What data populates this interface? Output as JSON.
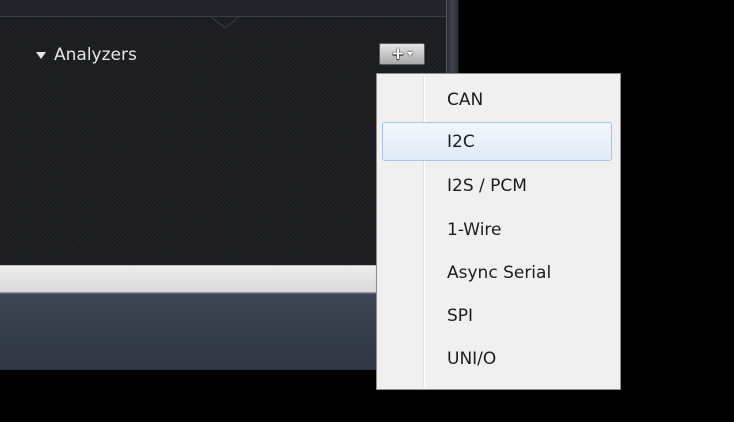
{
  "analyzers_panel": {
    "section_title": "Analyzers",
    "add_button_icon": "plus-icon",
    "add_button_dropdown_icon": "chevron-down-icon",
    "collapse_icon": "triangle-down-icon"
  },
  "add_analyzer_menu": {
    "items": [
      {
        "label": "CAN",
        "highlighted": false
      },
      {
        "label": "I2C",
        "highlighted": true
      },
      {
        "label": "I2S / PCM",
        "highlighted": false
      },
      {
        "label": "1-Wire",
        "highlighted": false
      },
      {
        "label": "Async Serial",
        "highlighted": false
      },
      {
        "label": "SPI",
        "highlighted": false
      },
      {
        "label": "UNI/O",
        "highlighted": false
      }
    ]
  },
  "colors": {
    "panel_background": "#1a1b1e",
    "menu_background": "#f0f0f0",
    "menu_highlight_border": "#a8c4e4",
    "bottom_bar": "#3e4654"
  }
}
